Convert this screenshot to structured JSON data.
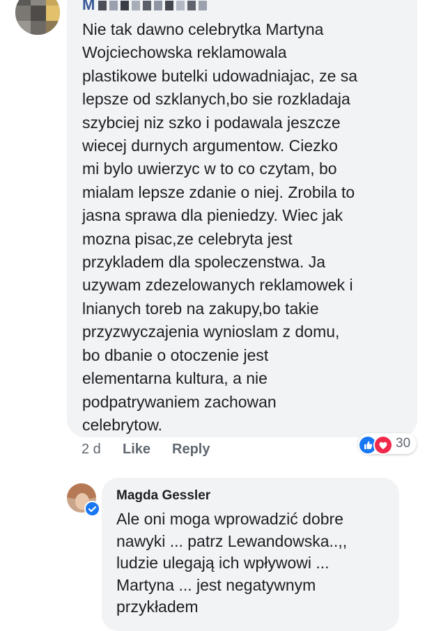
{
  "comment": {
    "author": "M",
    "body_lines": [
      "Nie tak dawno celebrytka Martyna",
      "Wojciechowska reklamowala",
      "plastikowe butelki udowadniajac, ze sa",
      "lepsze od szklanych,bo sie rozkladaja",
      "szybciej niz szko i podawala jeszcze",
      "wiecej durnych argumentow. Ciezko",
      "mi bylo  uwierzyc w to co czytam, bo",
      "mialam lepsze zdanie o niej. Zrobila to",
      "jasna sprawa dla pieniedzy. Wiec jak",
      "mozna pisac,ze celebryta jest",
      "przykladem dla spoleczenstwa. Ja",
      "uzywam zdezelowanych reklamowek i",
      "lnianych toreb na zakupy,bo takie",
      "przyzwyczajenia wynioslam z domu,",
      "bo dbanie o otoczenie jest",
      "elementarna kultura, a nie",
      "podpatrywaniem zachowan",
      "celebrytow."
    ],
    "time": "2 d",
    "like_label": "Like",
    "reply_label": "Reply",
    "reaction_icons": [
      "like-reaction-icon",
      "love-reaction-icon"
    ],
    "reaction_count": "30"
  },
  "reply": {
    "author": "Magda Gessler",
    "verified_icon": "verified-badge-icon",
    "body_lines": [
      "Ale oni moga wprowadzić dobre",
      "nawyki ... patrz Lewandowska..,,",
      "ludzie ulegają ich wpływowi ...",
      "Martyna ... jest negatywnym",
      "przykładem"
    ]
  },
  "colors": {
    "bubble": "#f2f3f5",
    "text": "#1c1e21",
    "link": "#385898",
    "meta": "#606770",
    "like_blue": "#1877f2",
    "love_red": "#f0284a"
  }
}
